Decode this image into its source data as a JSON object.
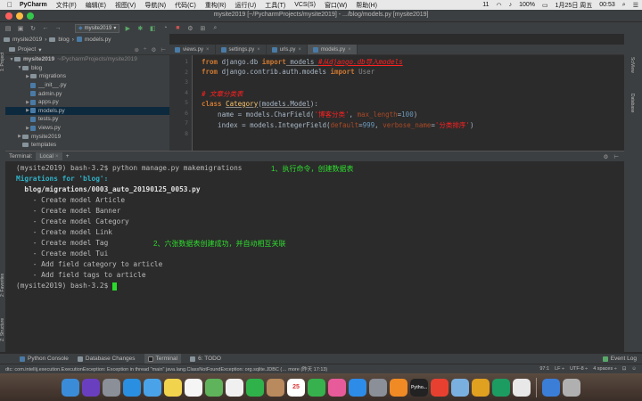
{
  "menubar": {
    "apple": "",
    "app": "PyCharm",
    "items": [
      "文件(F)",
      "编辑(E)",
      "视图(V)",
      "导航(N)",
      "代码(C)",
      "重构(R)",
      "运行(U)",
      "工具(T)",
      "VCS(S)",
      "窗口(W)",
      "帮助(H)"
    ],
    "right_items": [
      "11",
      "100%",
      "1月25日 周五",
      "00:53"
    ]
  },
  "window": {
    "title": "mysite2019 [~/PycharmProjects/mysite2019] - .../blog/models.py [mysite2019]"
  },
  "toolbar": {
    "run_config": "mysite2019"
  },
  "navbar": {
    "crumbs": [
      "mysite2019",
      "blog",
      "models.py"
    ]
  },
  "project_panel": {
    "header": "Project",
    "strip_labels": [
      "1: Project",
      "2: Favorites",
      "Z: Structure"
    ],
    "tree": [
      {
        "label": "mysite2019",
        "hint": "~/PycharmProjects/mysite2019",
        "type": "folder",
        "depth": 0,
        "open": true
      },
      {
        "label": "blog",
        "hint": "",
        "type": "folder",
        "depth": 1,
        "open": true
      },
      {
        "label": "migrations",
        "hint": "",
        "type": "folder",
        "depth": 2,
        "open": false
      },
      {
        "label": "__init__.py",
        "hint": "",
        "type": "py",
        "depth": 2
      },
      {
        "label": "admin.py",
        "hint": "",
        "type": "py",
        "depth": 2
      },
      {
        "label": "apps.py",
        "hint": "",
        "type": "py",
        "depth": 2,
        "arrow": true
      },
      {
        "label": "models.py",
        "hint": "",
        "type": "py",
        "depth": 2,
        "arrow": true,
        "selected": true
      },
      {
        "label": "tests.py",
        "hint": "",
        "type": "py",
        "depth": 2
      },
      {
        "label": "views.py",
        "hint": "",
        "type": "py",
        "depth": 2,
        "arrow": true
      },
      {
        "label": "mysite2019",
        "hint": "",
        "type": "folder",
        "depth": 1,
        "open": false
      },
      {
        "label": "templates",
        "hint": "",
        "type": "folder",
        "depth": 1
      }
    ]
  },
  "editor": {
    "tabs": [
      {
        "label": "views.py",
        "active": false
      },
      {
        "label": "settings.py",
        "active": false
      },
      {
        "label": "urls.py",
        "active": false
      },
      {
        "label": "models.py",
        "active": true
      }
    ],
    "line_numbers": [
      "1",
      "2",
      "3",
      "4",
      "5",
      "6",
      "7",
      "8"
    ],
    "code": {
      "l1_from": "from",
      "l1_mod": " django.db ",
      "l1_import": "import",
      "l1_name": " models ",
      "l1_comment": "#从django.db导入models",
      "l2_from": "from",
      "l2_mod": " django.contrib.auth.models ",
      "l2_import": "import",
      "l2_name": " User",
      "l4_comment": "# 文章分类表",
      "l5_class": "class",
      "l5_name": "Category",
      "l5_paren": "(",
      "l5_base": "models.Model",
      "l5_end": "):",
      "l6_a": "    name = models.CharField(",
      "l6_str": "'博客分类'",
      "l6_b": ", ",
      "l6_kw": "max_length",
      "l6_eq": "=",
      "l6_num": "100",
      "l6_end": ")",
      "l7_a": "    index = models.IntegerField(",
      "l7_kw1": "default",
      "l7_eq1": "=",
      "l7_num": "999",
      "l7_b": ", ",
      "l7_kw2": "verbose_name",
      "l7_eq2": "=",
      "l7_str": "'分类排序'",
      "l7_end": ")"
    }
  },
  "terminal": {
    "header_label": "Terminal:",
    "tab_label": "Local",
    "lines": {
      "cmd": "(mysite2019) bash-3.2$ python manage.py makemigrations",
      "mig_for": "Migrations for 'blog':",
      "mig_file": "  blog/migrations/0003_auto_20190125_0053.py",
      "ops": [
        "    - Create model Article",
        "    - Create model Banner",
        "    - Create model Category",
        "    - Create model Link",
        "    - Create model Tag",
        "    - Create model Tui",
        "    - Add field category to article",
        "    - Add field tags to article"
      ],
      "prompt": "(mysite2019) bash-3.2$ "
    },
    "annotations": {
      "a1": "1、执行命令，创建数据表",
      "a2": "2、六张数据表创建成功，并自动相互关联"
    }
  },
  "bottom_tabs": {
    "items": [
      "Python Console",
      "Database Changes",
      "Terminal",
      "6: TODO"
    ],
    "event_log": "Event Log"
  },
  "statusbar": {
    "message": "dtc: com.intellij.execution.ExecutionException: Exception in thread \"main\" java.lang.ClassNotFoundException: org.sqlite.JDBC (… more (昨天 17:13)",
    "position": "97:1",
    "line_sep": "LF ÷",
    "encoding": "UTF-8 ÷",
    "indent": "4 spaces ÷"
  },
  "dock": {
    "items": [
      "finder-icon",
      "siri-icon",
      "launchpad-icon",
      "safari-icon",
      "mail-icon",
      "notes-icon",
      "reminders-icon",
      "maps-icon",
      "photos-icon",
      "wechat-icon",
      "contacts-icon",
      "calendar-icon",
      "facetime-icon",
      "itunes-icon",
      "appstore-icon",
      "syspref-icon",
      "ibooks-icon",
      "terminal-icon",
      "qq-icon",
      "preview-icon",
      "sublime-icon",
      "pycharm-icon",
      "other-icon",
      "downloads-icon",
      "trash-icon"
    ],
    "calendar_day": "25",
    "thumb_label": "Pytho..."
  },
  "colors": {
    "menubar": "#e8e8e8",
    "ide_panel": "#3c3f41",
    "editor_bg": "#2b2b2b",
    "annotation": "#2edc2e",
    "keyword": "#cc7832",
    "string": "#6a8759",
    "comment": "#ff2020"
  }
}
